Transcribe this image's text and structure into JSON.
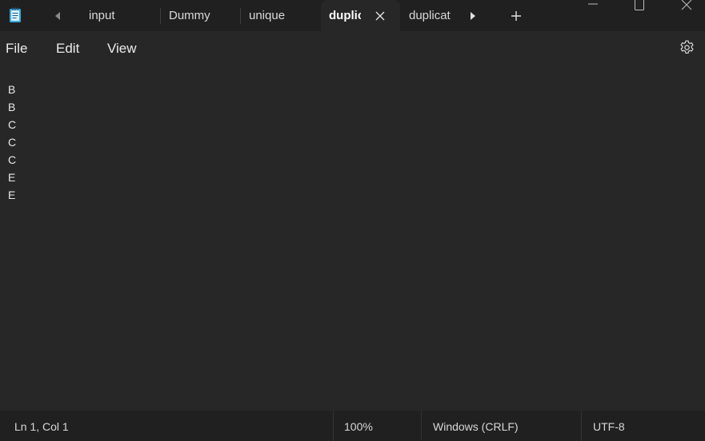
{
  "tabs": [
    {
      "label": "input",
      "active": false
    },
    {
      "label": "Dummy",
      "active": false
    },
    {
      "label": "unique",
      "active": false
    },
    {
      "label": "duplic",
      "active": true
    },
    {
      "label": "duplicat",
      "active": false
    }
  ],
  "menu": {
    "file": "File",
    "edit": "Edit",
    "view": "View"
  },
  "editor": {
    "lines": [
      "B",
      "B",
      "C",
      "C",
      "C",
      "E",
      "E"
    ]
  },
  "status": {
    "position": "Ln 1, Col 1",
    "zoom": "100%",
    "line_ending": "Windows (CRLF)",
    "encoding": "UTF-8"
  },
  "icons": {
    "app": "notepad-icon",
    "scroll_left": "caret-left-icon",
    "scroll_right": "caret-right-icon",
    "close_tab": "close-icon",
    "new_tab": "plus-icon",
    "settings": "gear-icon",
    "minimize": "minimize-icon",
    "maximize": "maximize-icon",
    "close_window": "close-window-icon"
  },
  "colors": {
    "background": "#272727",
    "chrome": "#202020",
    "text": "#e6e6e6",
    "accent": "#3da9e6"
  }
}
